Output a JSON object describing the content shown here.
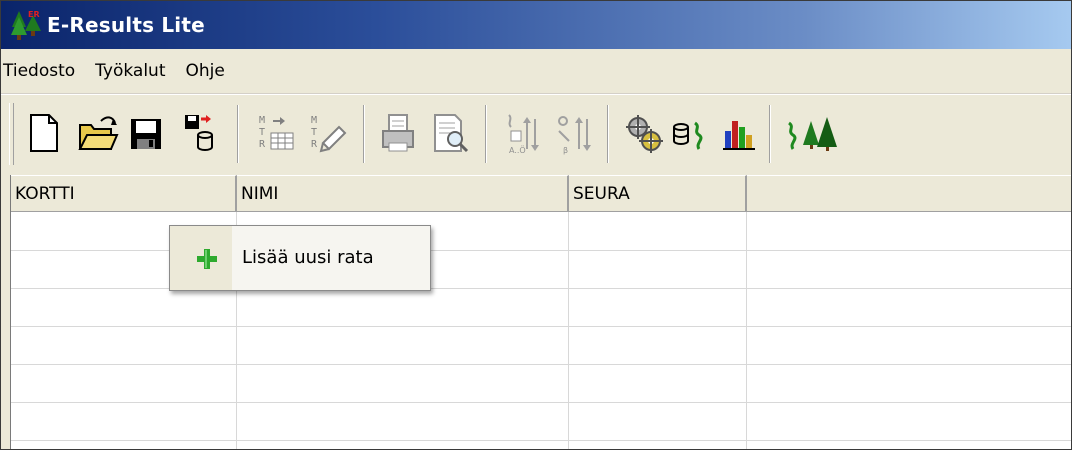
{
  "window": {
    "title": "E-Results Lite"
  },
  "menubar": {
    "items": [
      "Tiedosto",
      "Työkalut",
      "Ohje"
    ]
  },
  "toolbar": {
    "buttons": [
      {
        "icon": "new-document-icon"
      },
      {
        "icon": "open-folder-icon"
      },
      {
        "icon": "save-floppy-icon"
      },
      {
        "icon": "save-to-database-icon"
      },
      {
        "icon": "import-table-icon"
      },
      {
        "icon": "edit-names-icon"
      },
      {
        "icon": "print-icon"
      },
      {
        "icon": "print-preview-icon"
      },
      {
        "icon": "sort-ascending-icon"
      },
      {
        "icon": "sort-descending-icon"
      },
      {
        "icon": "settings-gears-icon"
      },
      {
        "icon": "database-runner-icon"
      },
      {
        "icon": "bar-chart-icon"
      },
      {
        "icon": "runner-trees-icon"
      }
    ]
  },
  "grid": {
    "columns": [
      "KORTTI",
      "NIMI",
      "SEURA",
      ""
    ]
  },
  "context_menu": {
    "items": [
      {
        "label": "Lisää uusi rata",
        "icon": "plus-icon"
      }
    ]
  },
  "colors": {
    "titlebar_start": "#0a246a",
    "titlebar_end": "#a6caf0",
    "face": "#ece9d8",
    "plus_green": "#2eaa2e"
  }
}
